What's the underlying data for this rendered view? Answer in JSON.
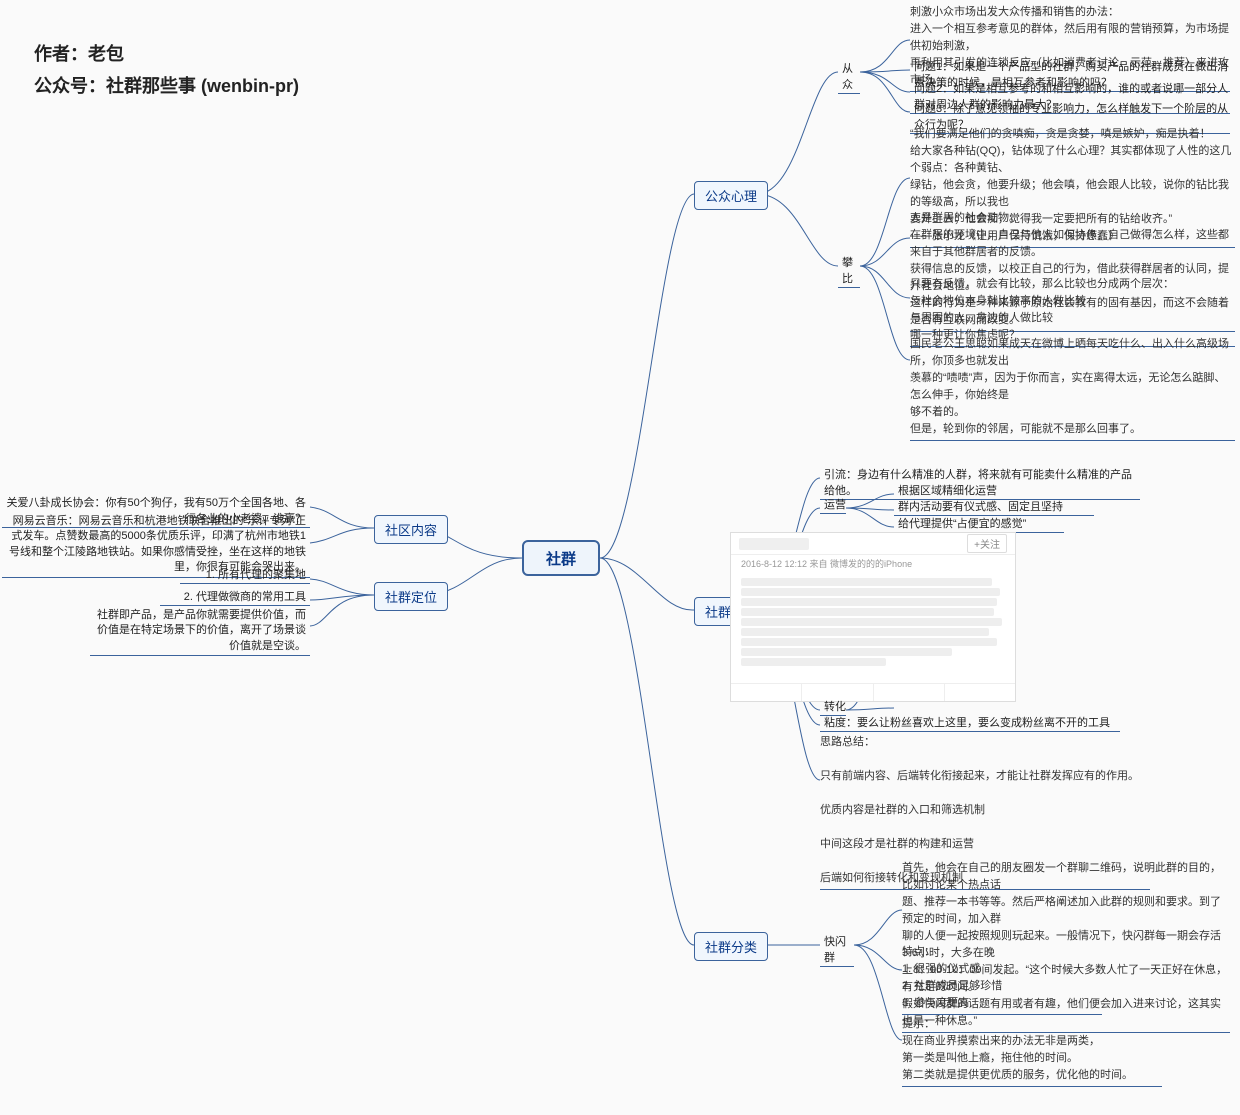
{
  "header": {
    "l1": "作者：老包",
    "l2": "公众号：社群那些事 (wenbin-pr)"
  },
  "root": "社群",
  "branch": {
    "left1": "社区内容",
    "left2": "社群定位",
    "r1": "公众心理",
    "r2": "社群营销",
    "r3": "社群分类"
  },
  "left1": {
    "a": "关爱八卦成长协会：你有50个狗仔，我有50万个全国各地、各行各业的小老婆，谁赢？",
    "b": "网易云音乐：网易云音乐和杭港地铁联合推出的“乐评专列”正式发车。点赞数最高的5000条优质乐评，印满了杭州市地铁1号线和整个江陵路地铁站。如果你感情受挫，坐在这样的地铁里，你很有可能会哭出来。"
  },
  "left2": {
    "a": "1. 所有代理的聚集地",
    "b": "2. 代理做微商的常用工具",
    "c": "社群即产品，是产品你就需要提供价值，而价值是在特定场景下的价值，离开了场景谈价值就是空谈。"
  },
  "psy": {
    "cz": "从众",
    "pb": "攀比",
    "cz_top": "刺激小众市场出发大众传播和销售的办法：\n进入一个相互参考意见的群体，然后用有限的营销预算，为市场提供初始刺激，\n再利用其引发的连锁反应（比如消费者讨论、示范、推荐）来进攻市场。",
    "cz_q1": "问题1：如果是一个产品型的社群，购买产品的社群成员在做出消费决策的时候，是相互参考和影响的吗？",
    "cz_q2": "问题2：如果是相互参考的和相互影响的，谁的或者说哪一部分人群对周边人群的影响力最大？",
    "cz_q3": "问题3：除了意见领袖的专业影响力，怎么样触发下一个阶层的从众行为呢？",
    "pb1": "“我们要满足他们的贪嗔痴，贪是贪婪，嗔是嫉妒，痴是执着！\n给大家各种钻(QQ)，钻体现了什么心理？其实都体现了人性的这几个弱点：各种黄钻、\n绿钻，他会贪，他要升级；他会嗔，他会跟人比较，说你的钻比我的等级高，所以我也\n要升上去；他会痴，觉得我一定要把所有的钻给收齐。”\n——张小龙《让用户保持饥饿，保持愚蠢》",
    "pb2": "人是群居的社会动物。\n在群居的环境中，自己与他人如何协作，自己做得怎么样，这些都来自于其他群居者的反馈。\n获得信息的反馈，以校正自己的行为，借此获得群居者的认同，提升社会地位。\n这样的行为是一种来源于原始社会教有的固有基因，而这不会随着是否有互联网而改变。",
    "pb3": "只要有反馈，就会有比较，那么比较也分成两个层次：\n与社会地位本身就比较高的人做比较\n与周围的人、身边的人做比较\n哪一种更让你焦虑呢？",
    "pb4": "国民老公王思聪如果成天在微博上晒每天吃什么、出入什么高级场所，你顶多也就发出\n羡慕的“啧啧”声，因为于你而言，实在离得太远，无论怎么踮脚、怎么伸手，你始终是\n够不着的。\n但是，轮到你的邻居，可能就不是那么回事了。"
  },
  "mkt": {
    "yy": "运营",
    "zh": "转化",
    "flow": "引流：身边有什么精准的人群，将来就有可能卖什么精准的产品给他。",
    "yy1": "根据区域精细化运营",
    "yy2": "群内活动要有仪式感、固定且坚持",
    "yy3": "给代理提供“占便宜的感觉”",
    "stick": "粘度：要么让粉丝喜欢上这里，要么变成粉丝离不开的工具",
    "sum": "思路总结：\n\n只有前端内容、后端转化衔接起来，才能让社群发挥应有的作用。\n\n优质内容是社群的入口和筛选机制\n\n中间这段才是社群的构建和运营\n\n后端如何衔接转化和变现机制"
  },
  "cat": {
    "k": "快闪群",
    "p1": "首先，他会在自己的朋友圈发一个群聊二维码，说明此群的目的，比如讨论某个热点话\n题、推荐一本书等等。然后严格阐述加入此群的规则和要求。到了预定的时间，加入群\n聊的人便一起按照规则玩起来。一般情况下，快闪群每一期会存活3-6小时，大多在晚\n上8：00-10：00间发起。“这个时候大多数人忙了一天正好在休息，有充足的时间。\n假如快闪群的话题有用或者有趣，他们便会加入进来讨论，这其实也是一种休息。”",
    "p2": "特点：\n1.  很强的仪式感\n2.  社群成员足够珍惜\n3.  参与度更高",
    "p3": "提示：\n现在商业界摸索出来的办法无非是两类，\n第一类是叫他上瘾，拖住他的时间。\n第二类就是提供更优质的服务，优化他的时间。"
  },
  "shot": {
    "btn": "+关注",
    "meta": "2016-8-12 12:12 来自 微博发的的的iPhone"
  }
}
